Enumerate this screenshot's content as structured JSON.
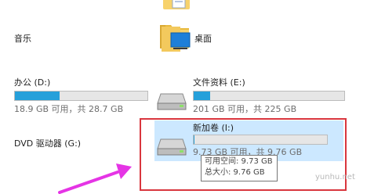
{
  "items": {
    "music": {
      "label": "音乐"
    },
    "desktop": {
      "label": "桌面"
    },
    "office": {
      "label": "办公 (D:)",
      "usage": "18.9 GB 可用，共 28.7 GB",
      "used_fraction": 0.34
    },
    "docs": {
      "label": "文件资料 (E:)",
      "usage": "201 GB 可用，共 225 GB",
      "used_fraction": 0.11
    },
    "dvd": {
      "label": "DVD 驱动器 (G:)"
    },
    "newvol": {
      "label": "新加卷 (I:)",
      "usage": "9.73 GB 可用，共 9.76 GB",
      "used_fraction": 0.003
    }
  },
  "tooltip": {
    "free": "可用空间: 9.73 GB",
    "total": "总大小: 9.76 GB"
  },
  "watermark": "yunhu.net",
  "colors": {
    "bar_fill": "#26a0da",
    "selection": "#cce8ff",
    "highlight_box": "#d9363e",
    "arrow": "#e534e5"
  },
  "icons": [
    "folder-doc-icon",
    "music-folder-icon",
    "desktop-folder-icon",
    "drive-icon"
  ]
}
